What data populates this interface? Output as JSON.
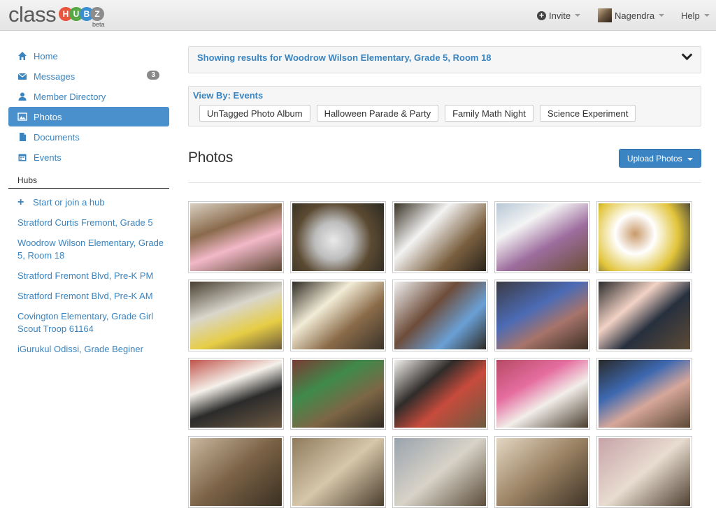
{
  "header": {
    "logo_class": "class",
    "logo_hubz": [
      "H",
      "U",
      "B",
      "Z"
    ],
    "logo_beta": "beta",
    "invite_label": "Invite",
    "user_label": "Nagendra",
    "help_label": "Help"
  },
  "sidebar": {
    "items": [
      {
        "label": "Home",
        "icon": "home-icon"
      },
      {
        "label": "Messages",
        "icon": "envelope-icon",
        "badge": "3"
      },
      {
        "label": "Member Directory",
        "icon": "user-icon"
      },
      {
        "label": "Photos",
        "icon": "picture-icon",
        "active": true
      },
      {
        "label": "Documents",
        "icon": "file-icon"
      },
      {
        "label": "Events",
        "icon": "calendar-icon"
      }
    ],
    "hubs_heading": "Hubs",
    "hubs": [
      "Start or join a hub",
      "Stratford Curtis Fremont, Grade 5",
      "Woodrow Wilson Elementary, Grade 5, Room 18",
      "Stratford Fremont Blvd, Pre-K PM",
      "Stratford Fremont Blvd, Pre-K AM",
      "Covington Elementary, Grade Girl Scout Troop 61164",
      "iGurukul Odissi, Grade Beginer"
    ]
  },
  "main": {
    "results_text": "Showing results for Woodrow Wilson Elementary, Grade 5, Room 18",
    "view_by_label": "View By: Events",
    "event_tags": [
      "UnTagged Photo Album",
      "Halloween Parade & Party",
      "Family Math Night",
      "Science Experiment"
    ],
    "section_title": "Photos",
    "upload_label": "Upload Photos"
  },
  "colors": {
    "accent": "#3a84c0",
    "active_bg": "#4a90cc",
    "bubble_h": "#e8543e",
    "bubble_u": "#55a845",
    "bubble_b": "#3a8fd0",
    "bubble_z": "#8c8c8c"
  }
}
